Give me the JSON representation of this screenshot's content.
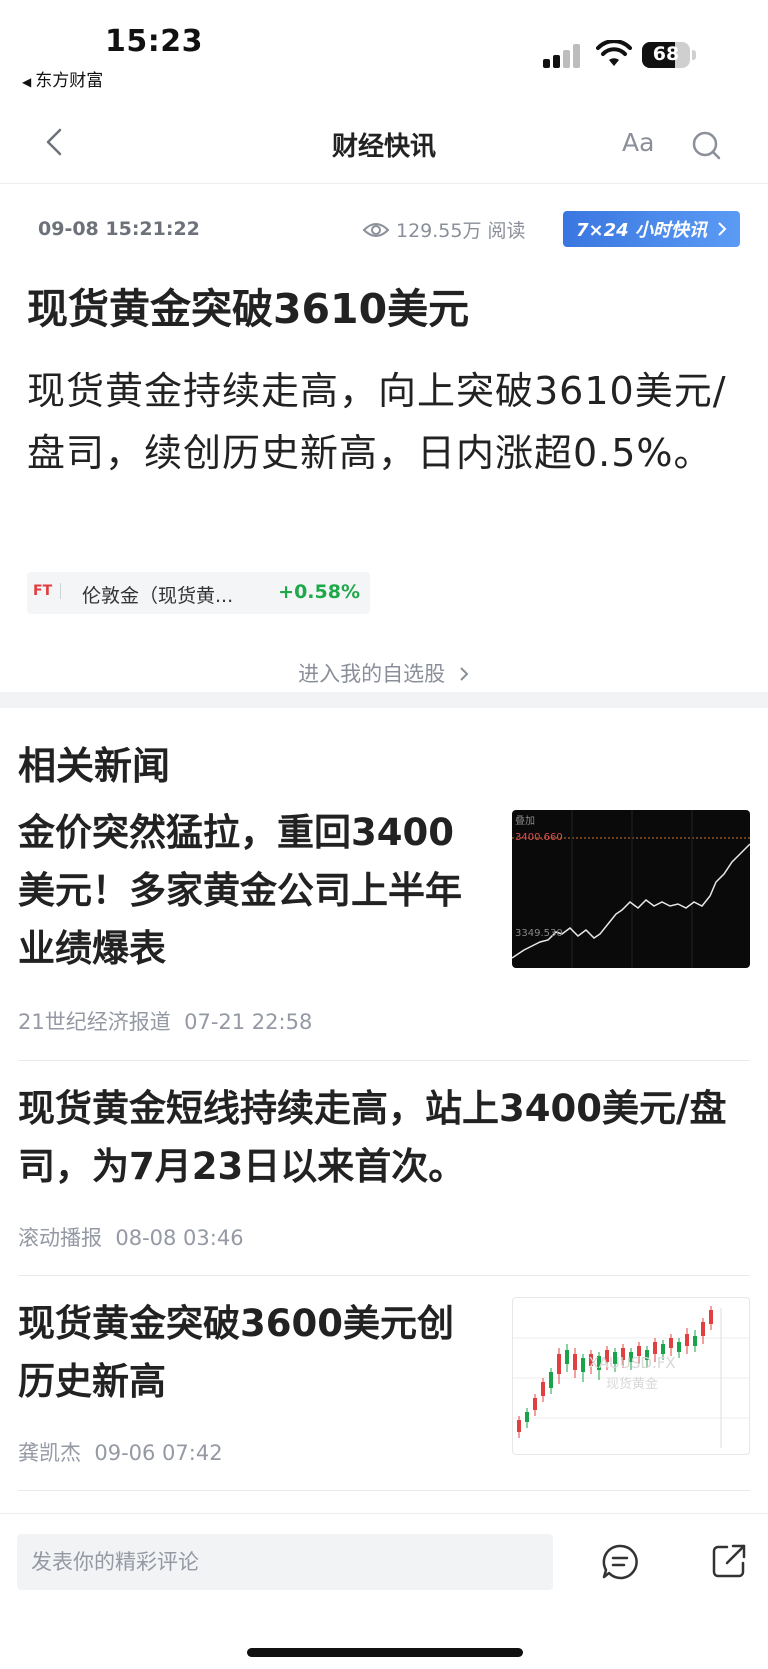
{
  "status_bar": {
    "time": "15:23",
    "back_app": "东方财富",
    "battery": "68",
    "battery_level": 0.68,
    "signal_bars_active": 2
  },
  "nav": {
    "title": "财经快讯",
    "font_button": "Aa",
    "icons": {
      "back": "chevron-left-icon",
      "search": "search-icon"
    }
  },
  "article": {
    "datetime": "09-08 15:21:22",
    "views": "129.55万 阅读",
    "badge": "7×24 小时快讯",
    "title": "现货黄金突破3610美元",
    "body": "现货黄金持续走高，向上突破3610美元/盘司，续创历史新高，日内涨超0.5%。",
    "stock": {
      "tag": "FT",
      "name": "伦敦金（现货黄...",
      "change": "+0.58%",
      "change_color": "#1fa84a"
    },
    "enter_link": "进入我的自选股"
  },
  "related": {
    "heading": "相关新闻",
    "items": [
      {
        "title": "金价突然猛拉，重回3400美元！多家黄金公司上半年业绩爆表",
        "source": "21世纪经济报道",
        "time": "07-21 22:58",
        "thumb": {
          "top_label": "叠加",
          "price_high": "3400.660",
          "price_low": "3349.530"
        }
      },
      {
        "title": "现货黄金短线持续走高，站上3400美元/盘司，为7月23日以来首次。",
        "source": "滚动播报",
        "time": "08-08 03:46"
      },
      {
        "title": "现货黄金突破3600美元创历史新高",
        "source": "龚凯杰",
        "time": "09-06 07:42",
        "thumb": {
          "watermark_symbol": "XAUUSD.FX",
          "watermark_name": "现货黄金"
        }
      }
    ]
  },
  "bottom_bar": {
    "comment_placeholder": "发表你的精彩评论",
    "icons": {
      "comment": "comment-icon",
      "share": "share-icon"
    }
  },
  "colors": {
    "accent_blue": "#3a76e0",
    "up_green": "#1fa84a",
    "up_red": "#e23c3c",
    "meta_gray": "#9499a3"
  }
}
